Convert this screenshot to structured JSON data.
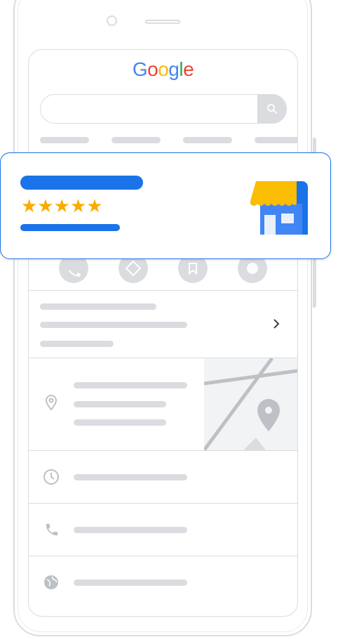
{
  "search": {
    "logo": [
      {
        "ch": "G",
        "color": "#4285f4"
      },
      {
        "ch": "o",
        "color": "#ea4335"
      },
      {
        "ch": "o",
        "color": "#fbbc04"
      },
      {
        "ch": "g",
        "color": "#4285f4"
      },
      {
        "ch": "l",
        "color": "#34a853"
      },
      {
        "ch": "e",
        "color": "#ea4335"
      }
    ],
    "search_icon": "search-icon"
  },
  "business_card": {
    "rating_stars": "★★★★★",
    "rating_value": 5,
    "rating_max": 5,
    "icon": "storefront-icon"
  },
  "actions": [
    "phone-icon",
    "directions-icon",
    "bookmark-icon",
    "globe-icon"
  ],
  "rows": [
    {
      "icon": "chevron-right-icon"
    },
    {
      "icon": "location-pin-icon"
    },
    {
      "icon": "clock-icon"
    },
    {
      "icon": "phone-icon"
    },
    {
      "icon": "globe-icon"
    }
  ],
  "colors": {
    "accent_blue": "#1a73e8",
    "star_yellow": "#f9ab00",
    "awning_yellow": "#fbbc04",
    "placeholder_gray": "#dadce0"
  }
}
